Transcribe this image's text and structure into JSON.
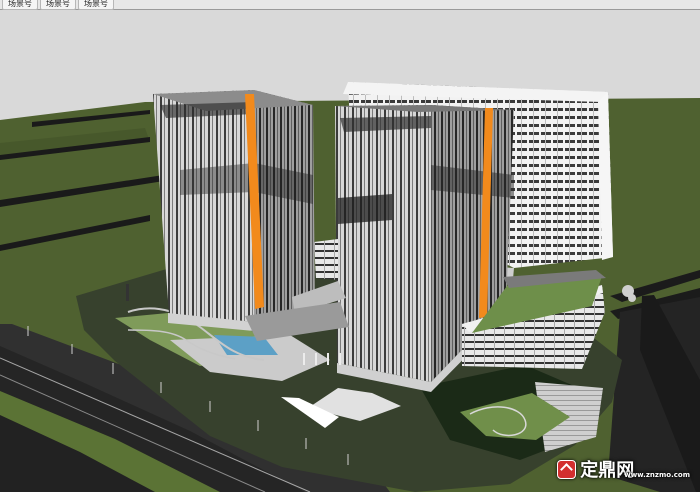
{
  "scene_tabs": [
    "场景号",
    "场景号",
    "场景号"
  ],
  "watermark": {
    "text": "定鼎网",
    "url": "www.znzmo.com"
  },
  "colors": {
    "sky": "#d9d9d9",
    "grass": "#4f6130",
    "grass_light": "#66853a",
    "road": "#1f1f1f",
    "accent": "#f28a1c"
  }
}
